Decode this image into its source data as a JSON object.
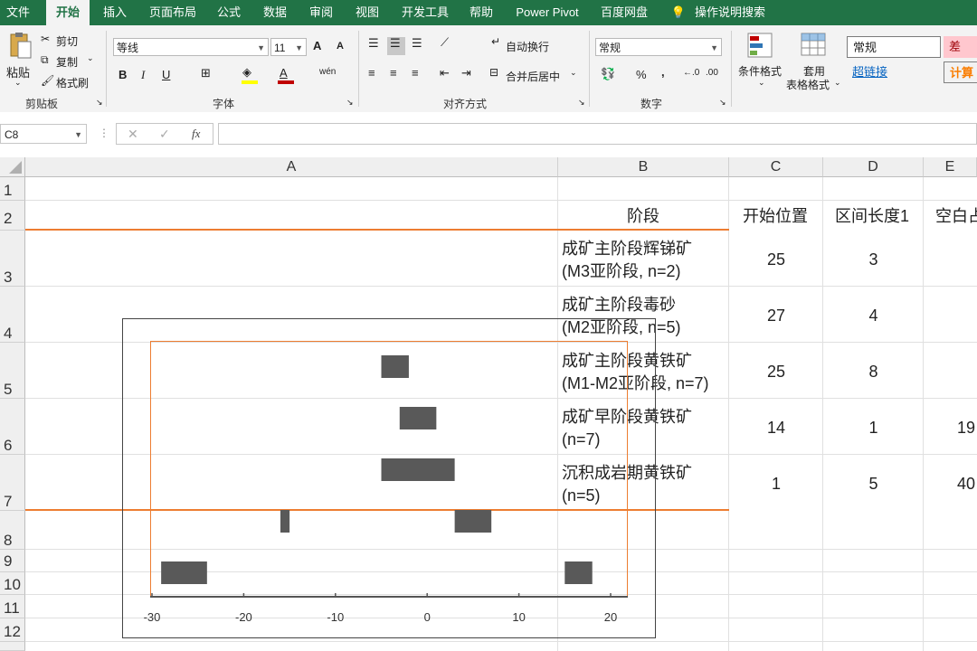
{
  "ribbon_tabs": [
    "文件",
    "开始",
    "插入",
    "页面布局",
    "公式",
    "数据",
    "审阅",
    "视图",
    "开发工具",
    "帮助",
    "Power Pivot",
    "百度网盘",
    "操作说明搜索"
  ],
  "active_tab": "开始",
  "clipboard": {
    "paste": "粘贴",
    "cut": "剪切",
    "copy": "复制",
    "format_painter": "格式刷",
    "label": "剪贴板"
  },
  "font": {
    "name": "等线",
    "size": "11",
    "label": "字体",
    "bold": "B",
    "italic": "I",
    "underline": "U",
    "grow": "A",
    "shrink": "A",
    "phonetic": "wén"
  },
  "alignment": {
    "wrap": "自动换行",
    "merge": "合并后居中",
    "label": "对齐方式"
  },
  "number": {
    "format": "常规",
    "label": "数字",
    "percent": "%",
    "comma": ","
  },
  "styles": {
    "conditional": "条件格式",
    "table_line1": "套用",
    "table_line2": "表格格式",
    "normal": "常规",
    "bad": "差",
    "hyperlink": "超链接",
    "calc": "计算"
  },
  "name_box": "C8",
  "formula_icons": {
    "cancel": "✕",
    "enter": "✓",
    "fx": "fx"
  },
  "columns": [
    "A",
    "B",
    "C",
    "D",
    "E"
  ],
  "rows": [
    "1",
    "2",
    "3",
    "4",
    "5",
    "6",
    "7",
    "8",
    "9",
    "10",
    "11",
    "12"
  ],
  "headers": {
    "b": "阶段",
    "c": "开始位置",
    "d": "区间长度1",
    "e": "空白占"
  },
  "table_rows": [
    {
      "b1": "成矿主阶段辉锑矿",
      "b2": "(M3亚阶段, n=2)",
      "c": "25",
      "d": "3",
      "e": ""
    },
    {
      "b1": "成矿主阶段毒砂",
      "b2": "(M2亚阶段, n=5)",
      "c": "27",
      "d": "4",
      "e": ""
    },
    {
      "b1": "成矿主阶段黄铁矿",
      "b2": "(M1-M2亚阶段, n=7)",
      "c": "25",
      "d": "8",
      "e": ""
    },
    {
      "b1": "成矿早阶段黄铁矿",
      "b2": "(n=7)",
      "c": "14",
      "d": "1",
      "e": "19"
    },
    {
      "b1": "沉积成岩期黄铁矿",
      "b2": "(n=5)",
      "c": "1",
      "d": "5",
      "e": "40"
    }
  ],
  "colors": {
    "ribbon_green": "#217346",
    "bar": "#595959",
    "accent_orange": "#ed7d31",
    "bad_fill": "#ffc7ce",
    "bad_text": "#9c0006",
    "calc_text": "#fa7d00"
  },
  "chart_data": {
    "type": "bar",
    "orientation": "horizontal-floating",
    "xlim": [
      -30,
      20
    ],
    "xticks": [
      "-30",
      "-20",
      "-10",
      "0",
      "10",
      "20"
    ],
    "bars": [
      {
        "start": -5,
        "end": -2
      },
      {
        "start": -3,
        "end": 1
      },
      {
        "start": -5,
        "end": 3
      },
      {
        "start": -16,
        "end": -15
      },
      {
        "start": 3,
        "end": 7
      },
      {
        "start": -29,
        "end": -24
      },
      {
        "start": 15,
        "end": 18
      }
    ]
  }
}
